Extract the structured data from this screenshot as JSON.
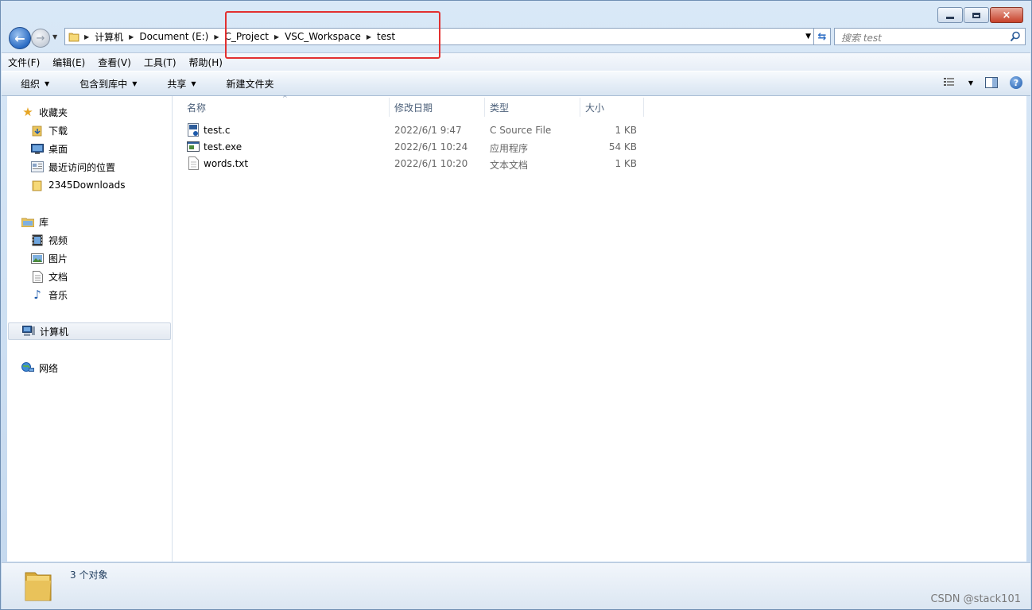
{
  "window": {
    "caption_buttons": {
      "minimize": "minimize",
      "maximize": "maximize",
      "close": "×"
    }
  },
  "nav": {
    "breadcrumbs": [
      "计算机",
      "Document (E:)",
      "C_Project",
      "VSC_Workspace",
      "test"
    ],
    "search_placeholder": "搜索 test"
  },
  "menubar": [
    "文件(F)",
    "编辑(E)",
    "查看(V)",
    "工具(T)",
    "帮助(H)"
  ],
  "toolbar": {
    "organize": "组织",
    "include_library": "包含到库中",
    "share": "共享",
    "new_folder": "新建文件夹"
  },
  "sidebar": {
    "favorites": {
      "label": "收藏夹",
      "items": [
        "下载",
        "桌面",
        "最近访问的位置",
        "2345Downloads"
      ]
    },
    "libraries": {
      "label": "库",
      "items": [
        "视频",
        "图片",
        "文档",
        "音乐"
      ]
    },
    "computer": "计算机",
    "network": "网络"
  },
  "columns": {
    "name": "名称",
    "modified": "修改日期",
    "type": "类型",
    "size": "大小"
  },
  "files": [
    {
      "name": "test.c",
      "modified": "2022/6/1 9:47",
      "type": "C Source File",
      "size": "1 KB",
      "icon": "c-source-file-icon"
    },
    {
      "name": "test.exe",
      "modified": "2022/6/1 10:24",
      "type": "应用程序",
      "size": "54 KB",
      "icon": "exe-file-icon"
    },
    {
      "name": "words.txt",
      "modified": "2022/6/1 10:20",
      "type": "文本文档",
      "size": "1 KB",
      "icon": "text-file-icon"
    }
  ],
  "status": {
    "count": "3 个对象"
  },
  "watermark": "CSDN @stack101",
  "colors": {
    "highlight_box": "#e23030",
    "accent": "#2b6cc4"
  }
}
